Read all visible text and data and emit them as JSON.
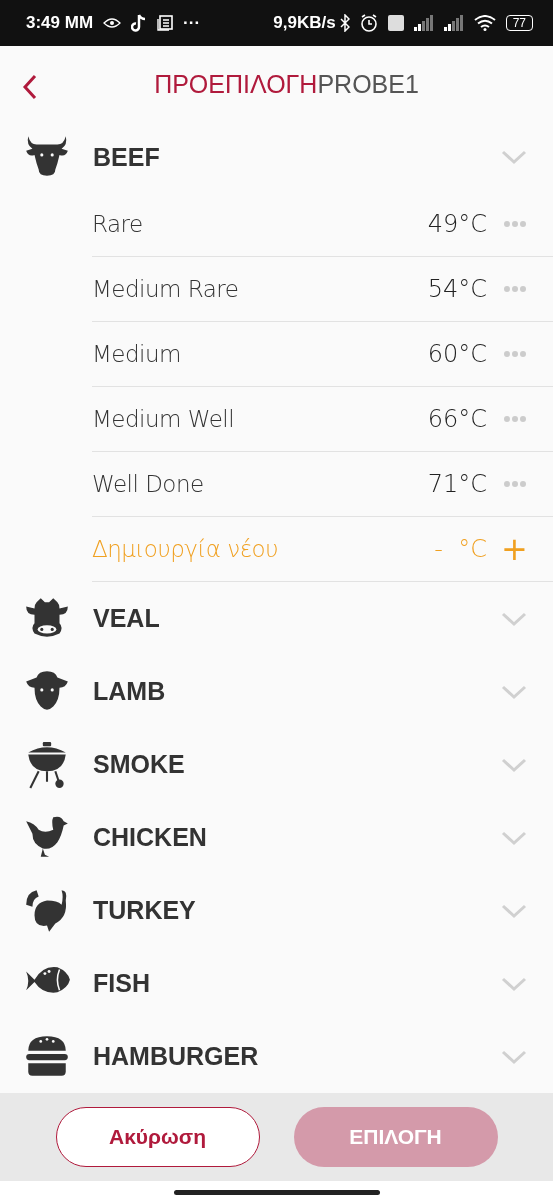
{
  "status_bar": {
    "time": "3:49 MM",
    "dots": "···",
    "speed": "9,9KB/s",
    "battery": "77"
  },
  "header": {
    "title_accent": "ΠΡΟΕΠΙΛΟΓΗ",
    "title_rest": "PROBE1"
  },
  "categories": [
    {
      "name": "BEEF",
      "kind": "bull",
      "presets": [
        {
          "name": "Rare",
          "temp": "49°C"
        },
        {
          "name": "Medium Rare",
          "temp": "54°C"
        },
        {
          "name": "Medium",
          "temp": "60°C"
        },
        {
          "name": "Medium Well",
          "temp": "66°C"
        },
        {
          "name": "Well Done",
          "temp": "71°C"
        }
      ],
      "new_preset": {
        "label": "Δημιουργία νέου",
        "temp": "-  °C",
        "add": "+"
      }
    },
    {
      "name": "VEAL",
      "kind": "cow"
    },
    {
      "name": "LAMB",
      "kind": "sheep"
    },
    {
      "name": "SMOKE",
      "kind": "grill"
    },
    {
      "name": "CHICKEN",
      "kind": "chicken"
    },
    {
      "name": "TURKEY",
      "kind": "turkey"
    },
    {
      "name": "FISH",
      "kind": "fish"
    },
    {
      "name": "HAMBURGER",
      "kind": "burger"
    }
  ],
  "buttons": [
    {
      "label": "Ακύρωση",
      "kind": "outline",
      "disabled": false
    },
    {
      "label": "ΕΠΙΛΟΓΗ",
      "kind": "filled",
      "disabled": true
    }
  ]
}
